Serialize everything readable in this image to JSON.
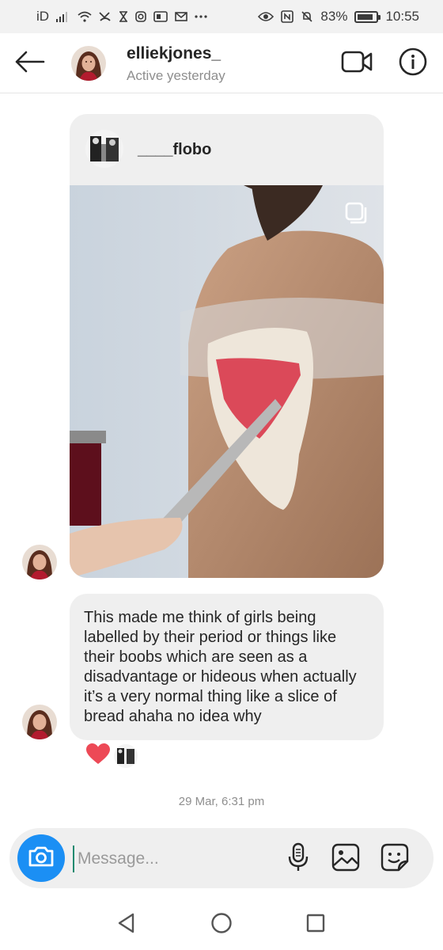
{
  "status_bar": {
    "left_text": "iD",
    "battery": "83%",
    "battery_level": 0.83,
    "time": "10:55"
  },
  "header": {
    "username": "elliekjones_",
    "status": "Active yesterday"
  },
  "shared_post": {
    "username": "____flobo"
  },
  "message": {
    "text": "This made me think of girls being labelled by their period or things like their boobs which are seen as a disadvantage or hideous when actually it’s a very normal thing like a slice of bread ahaha no idea why"
  },
  "timestamp": "29 Mar, 6:31 pm",
  "composer": {
    "placeholder": "Message..."
  },
  "icons": {
    "back": "back-arrow-icon",
    "video": "video-call-icon",
    "info": "info-icon",
    "camera": "camera-icon",
    "mic": "microphone-icon",
    "gallery": "gallery-icon",
    "sticker": "sticker-icon",
    "nav_back": "triangle-back-icon",
    "nav_home": "circle-home-icon",
    "nav_recent": "square-recents-icon"
  },
  "colors": {
    "accent": "#1b8ff4",
    "heart": "#ed4956",
    "bubble": "#efefef"
  }
}
